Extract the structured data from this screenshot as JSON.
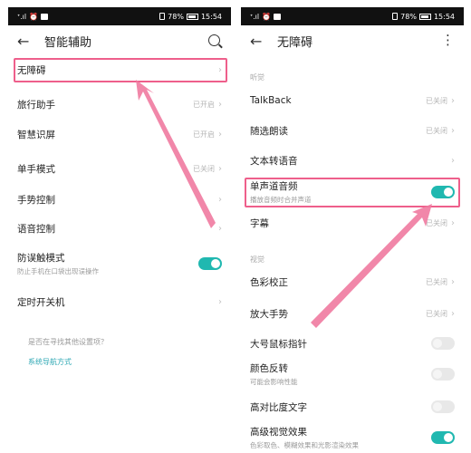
{
  "status_bar": {
    "signal": "ᐩ.ıl",
    "battery_percent": "78%",
    "time": "15:54"
  },
  "left_screen": {
    "title": "智能辅助",
    "items": [
      {
        "label": "无障碍",
        "status": ""
      },
      {
        "label": "旅行助手",
        "status": "已开启"
      },
      {
        "label": "智慧识屏",
        "status": "已开启"
      },
      {
        "label": "单手模式",
        "status": "已关闭"
      },
      {
        "label": "手势控制",
        "status": ""
      },
      {
        "label": "语音控制",
        "status": ""
      },
      {
        "label": "防误触模式",
        "subtitle": "防止手机在口袋出现误操作",
        "toggle_on": true
      },
      {
        "label": "定时开关机",
        "status": ""
      }
    ],
    "prompt": "是否在寻找其他设置项？",
    "link": "系统导航方式"
  },
  "right_screen": {
    "title": "无障碍",
    "sections": [
      {
        "header": "听觉",
        "items": [
          {
            "label": "TalkBack",
            "status": "已关闭"
          },
          {
            "label": "随选朗读",
            "status": "已关闭"
          },
          {
            "label": "文本转语音",
            "status": ""
          },
          {
            "label": "单声道音频",
            "subtitle": "播放音频时合并声道",
            "toggle_on": true
          },
          {
            "label": "字幕",
            "status": "已关闭"
          }
        ]
      },
      {
        "header": "视觉",
        "items": [
          {
            "label": "色彩校正",
            "status": "已关闭"
          },
          {
            "label": "放大手势",
            "status": "已关闭"
          },
          {
            "label": "大号鼠标指针",
            "toggle_on": false
          },
          {
            "label": "颜色反转",
            "subtitle": "可能会影响性能",
            "toggle_on": false
          },
          {
            "label": "高对比度文字",
            "toggle_on": false
          },
          {
            "label": "高级视觉效果",
            "subtitle": "色彩取色、模糊效果和光影渲染效果",
            "toggle_on": true
          }
        ]
      }
    ]
  },
  "colors": {
    "accent": "#20b8b0",
    "highlight": "#ee5f8b",
    "link": "#2fa8b4"
  }
}
